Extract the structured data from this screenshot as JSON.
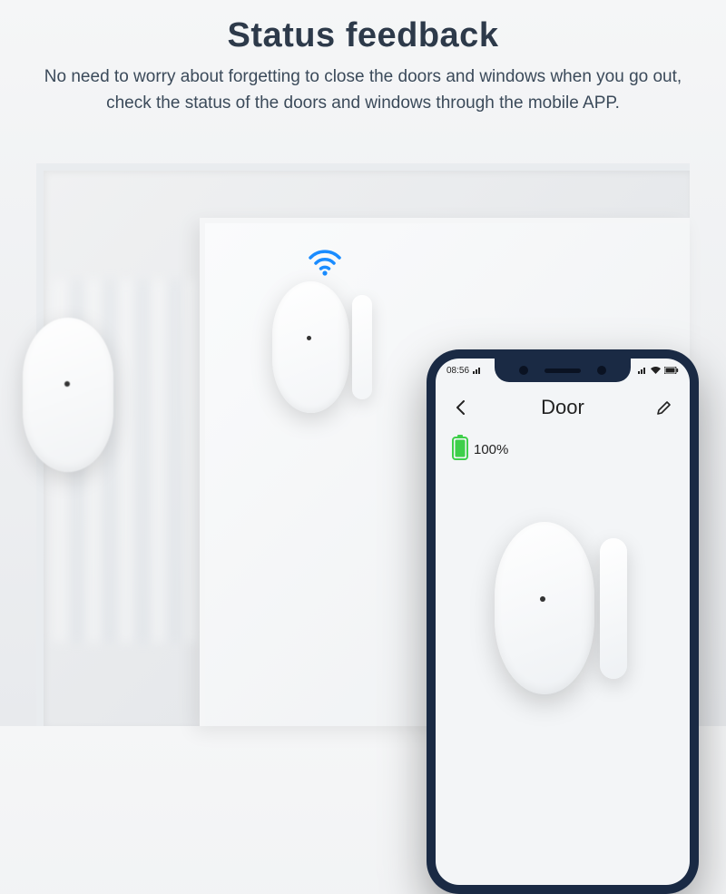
{
  "header": {
    "title": "Status feedback",
    "subtitle": "No need to worry about forgetting to close the doors and windows when you go out, check the status of the doors and windows through the mobile APP."
  },
  "phone": {
    "status_bar": {
      "time": "08:56"
    },
    "app": {
      "title": "Door",
      "battery_percent": "100%"
    }
  },
  "colors": {
    "accent": "#1a8cff",
    "battery_green": "#3ecf4a"
  }
}
